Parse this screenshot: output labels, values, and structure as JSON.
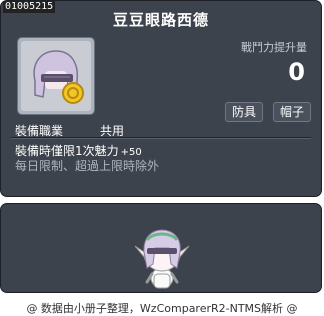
{
  "item": {
    "id": "01005215",
    "name": "豆豆眼路西德",
    "power_label": "戰鬥力提升量",
    "power_value": "0",
    "tags": [
      "防具",
      "帽子"
    ],
    "job_label": "裝備職業",
    "job_value": "共用",
    "effect_text": "裝備時僅限1次魅力",
    "effect_bonus": "+50",
    "limit_text": "每日限制、超過上限時除外"
  },
  "footer": {
    "credit": "@ 数据由小册子整理，WzComparerR2-NTMS解析 @"
  },
  "icons": {
    "item_icon": "hat-icon",
    "character": "character-preview"
  }
}
